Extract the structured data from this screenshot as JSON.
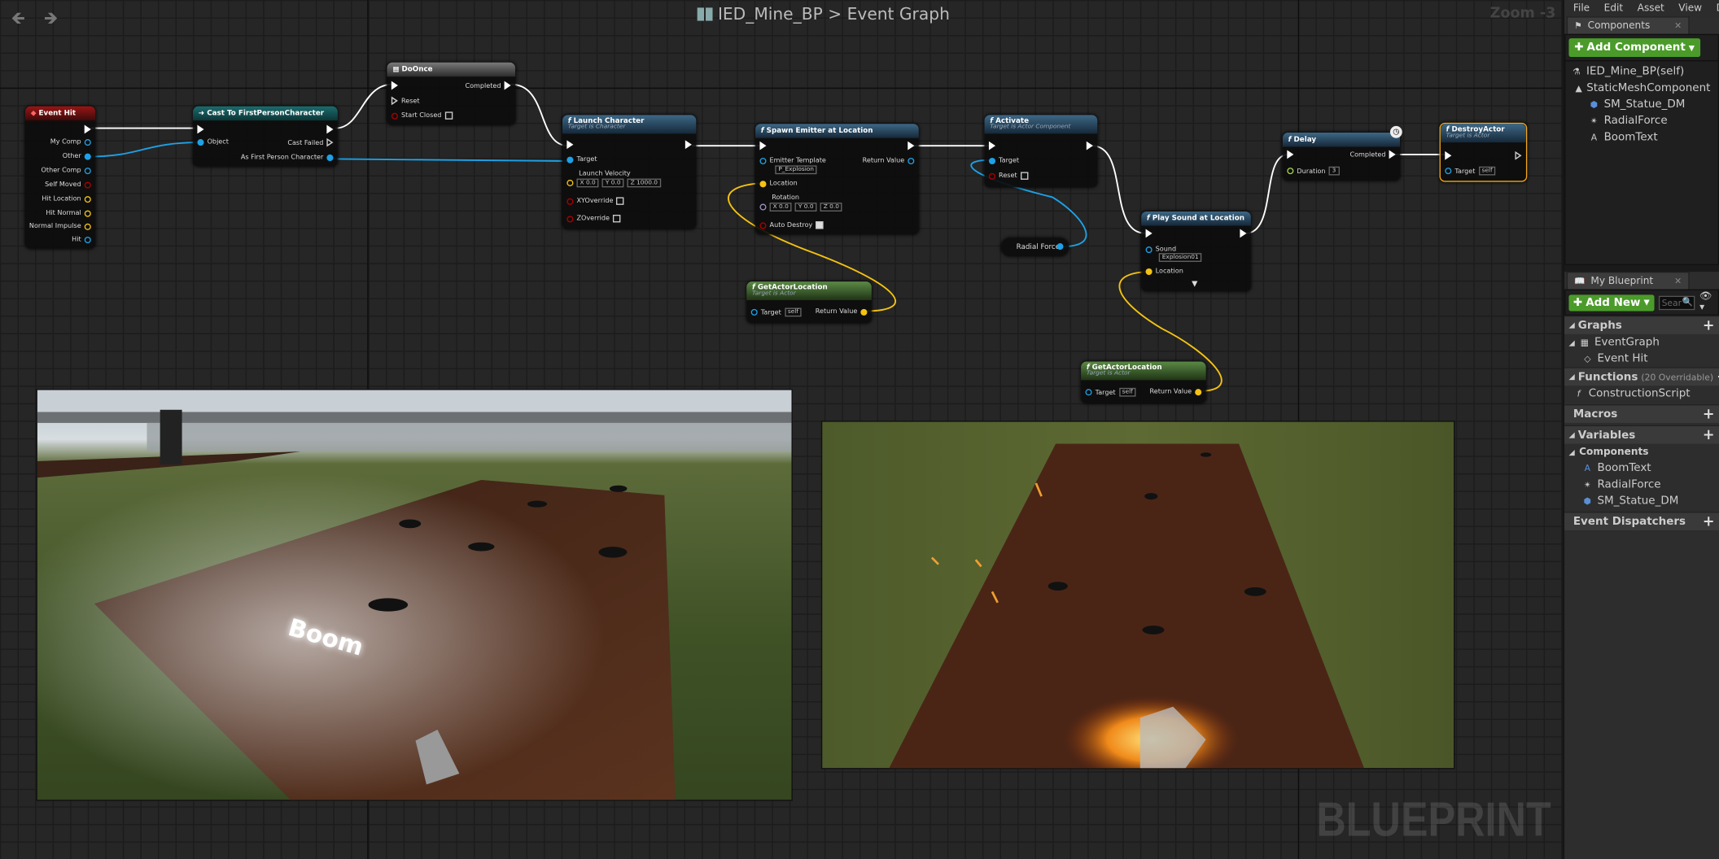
{
  "breadcrumb": {
    "blueprint": "IED_Mine_BP",
    "separator": ">",
    "graph": "Event Graph"
  },
  "zoom": "Zoom -3",
  "watermark": "BLUEPRINT",
  "nodes": {
    "event_hit": {
      "title": "Event Hit",
      "pins": [
        "My Comp",
        "Other",
        "Other Comp",
        "Self Moved",
        "Hit Location",
        "Hit Normal",
        "Normal Impulse",
        "Hit"
      ]
    },
    "cast": {
      "title": "Cast To FirstPersonCharacter",
      "object": "Object",
      "cast_failed": "Cast Failed",
      "as_fpc": "As First Person Character"
    },
    "doonce": {
      "title": "DoOnce",
      "completed": "Completed",
      "reset": "Reset",
      "start_closed": "Start Closed"
    },
    "launch": {
      "title": "Launch Character",
      "subtitle": "Target is Character",
      "target": "Target",
      "launch_velocity": "Launch Velocity",
      "vx": "X 0.0",
      "vy": "Y 0.0",
      "vz": "Z 1000.0",
      "xy_override": "XYOverride",
      "z_override": "ZOverride"
    },
    "spawn": {
      "title": "Spawn Emitter at Location",
      "emitter_template": "Emitter Template",
      "emitter_value": "P_Explosion",
      "return_value": "Return Value",
      "location": "Location",
      "rotation": "Rotation",
      "rx": "X 0.0",
      "ry": "Y 0.0",
      "rz": "Z 0.0",
      "auto_destroy": "Auto Destroy"
    },
    "activate": {
      "title": "Activate",
      "subtitle": "Target is Actor Component",
      "target": "Target",
      "reset": "Reset"
    },
    "radial": {
      "title": "Radial Force"
    },
    "delay": {
      "title": "Delay",
      "completed": "Completed",
      "duration": "Duration",
      "duration_value": "3"
    },
    "destroy": {
      "title": "DestroyActor",
      "subtitle": "Target is Actor",
      "target": "Target",
      "target_value": "self"
    },
    "playsound": {
      "title": "Play Sound at Location",
      "sound": "Sound",
      "sound_value": "Explosion01",
      "location": "Location"
    },
    "getloc1": {
      "title": "GetActorLocation",
      "subtitle": "Target is Actor",
      "target": "Target",
      "target_value": "self",
      "return_value": "Return Value"
    },
    "getloc2": {
      "title": "GetActorLocation",
      "subtitle": "Target is Actor",
      "target": "Target",
      "target_value": "self",
      "return_value": "Return Value"
    }
  },
  "scene": {
    "boom_text": "Boom"
  },
  "panel": {
    "menu": [
      "File",
      "Edit",
      "Asset",
      "View",
      "D"
    ],
    "components_tab": "Components",
    "add_component": "Add Component",
    "components": [
      "IED_Mine_BP(self)",
      "StaticMeshComponent (Inhe",
      "SM_Statue_DM",
      "RadialForce",
      "BoomText"
    ],
    "my_blueprint_tab": "My Blueprint",
    "add_new": "Add New",
    "search_placeholder": "Sear",
    "graphs_label": "Graphs",
    "event_graph": "EventGraph",
    "event_hit": "Event Hit",
    "functions_label": "Functions",
    "functions_count": "(20 Overridable)",
    "construction_script": "ConstructionScript",
    "macros_label": "Macros",
    "variables_label": "Variables",
    "components_label": "Components",
    "var_components": [
      "BoomText",
      "RadialForce",
      "SM_Statue_DM"
    ],
    "event_dispatchers": "Event Dispatchers"
  }
}
